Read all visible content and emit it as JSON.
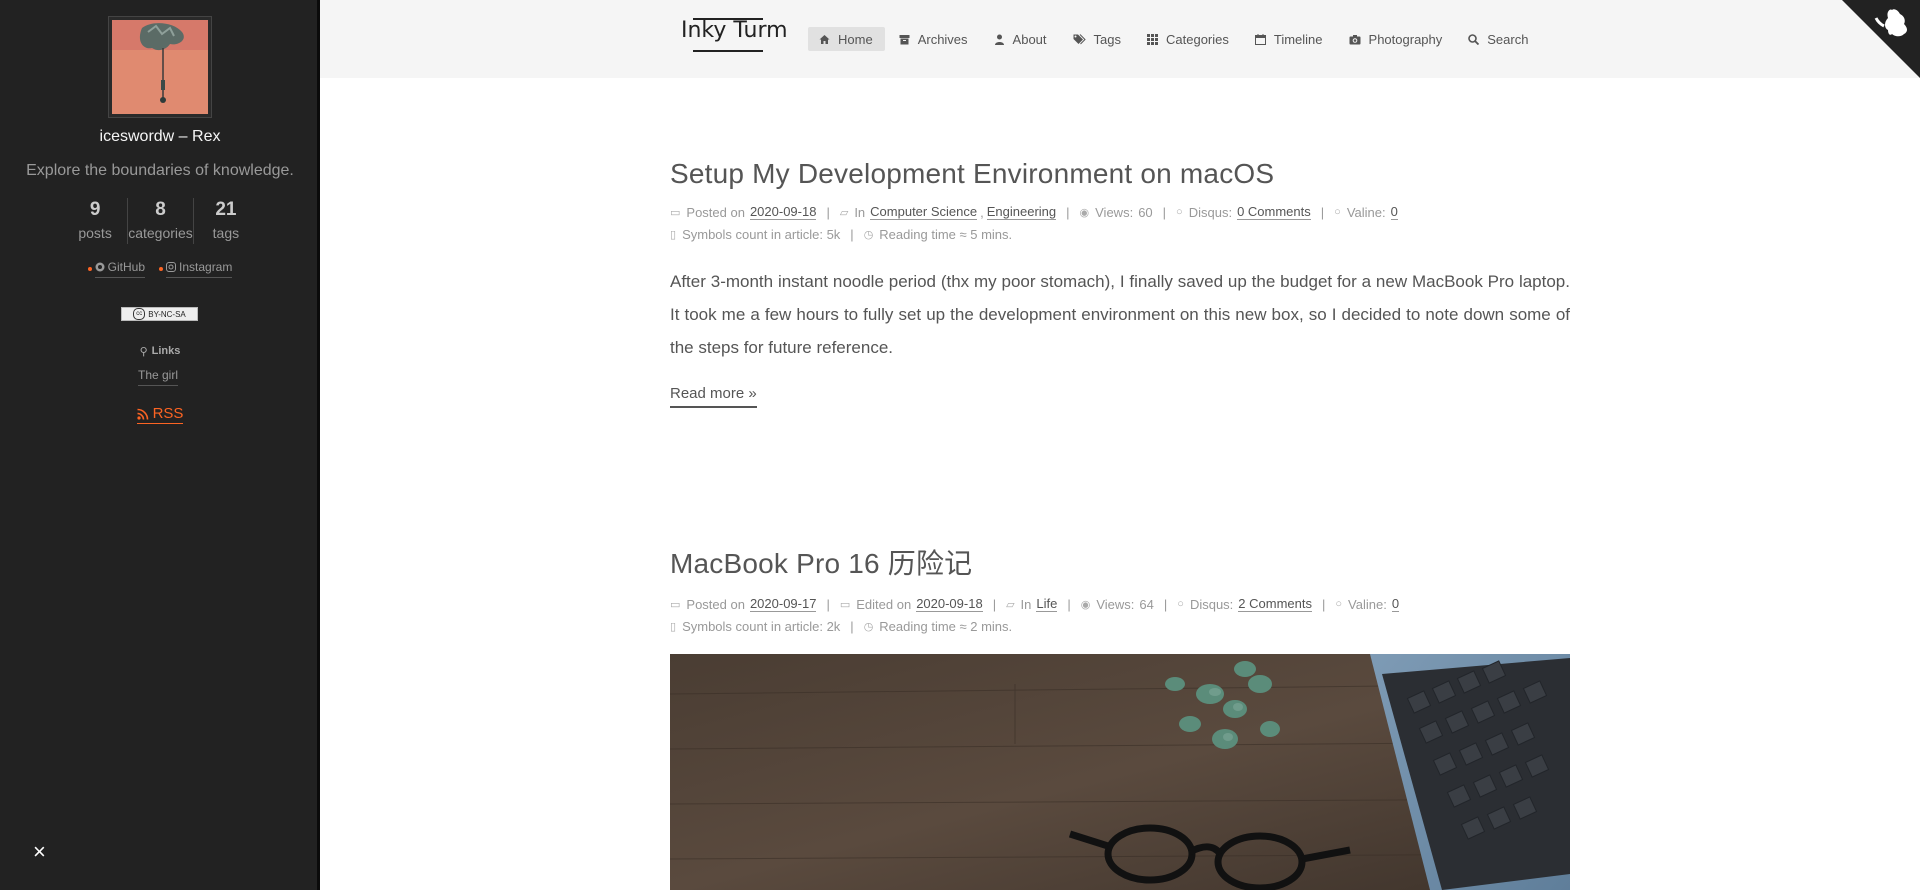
{
  "sidebar": {
    "author": "iceswordw – Rex",
    "motto": "Explore the boundaries of knowledge.",
    "stats": [
      {
        "num": "9",
        "label": "posts"
      },
      {
        "num": "8",
        "label": "categories"
      },
      {
        "num": "21",
        "label": "tags"
      }
    ],
    "social": [
      {
        "icon": "github-icon",
        "label": "GitHub"
      },
      {
        "icon": "instagram-icon",
        "label": "Instagram"
      }
    ],
    "license": "BY-NC-SA",
    "links_title": "Links",
    "links": [
      "The girl"
    ],
    "rss": "RSS",
    "close": "×"
  },
  "header": {
    "brand": "Inky Turm",
    "nav": [
      {
        "label": "Home",
        "icon": "home-icon"
      },
      {
        "label": "Archives",
        "icon": "archive-icon"
      },
      {
        "label": "About",
        "icon": "user-icon"
      },
      {
        "label": "Tags",
        "icon": "tags-icon"
      },
      {
        "label": "Categories",
        "icon": "grid-icon"
      },
      {
        "label": "Timeline",
        "icon": "calendar-icon"
      },
      {
        "label": "Photography",
        "icon": "camera-icon"
      },
      {
        "label": "Search",
        "icon": "search-icon"
      }
    ]
  },
  "posts": [
    {
      "title": "Setup My Development Environment on macOS",
      "posted_label": "Posted on",
      "posted": "2020-09-18",
      "in_label": "In",
      "categories": [
        "Computer Science",
        "Engineering"
      ],
      "views_label": "Views:",
      "views": "60",
      "disqus_label": "Disqus:",
      "disqus": "0 Comments",
      "valine_label": "Valine:",
      "valine": "0",
      "symbols": "Symbols count in article: 5k",
      "reading": "Reading time ≈ 5 mins.",
      "excerpt": "After 3-month instant noodle period (thx my poor stomach), I finally saved up the budget for a new MacBook Pro laptop. It took me a few hours to fully set up the development environment on this new box, so I decided to note down some of the steps for future reference.",
      "read_more": "Read more »"
    },
    {
      "title": "MacBook Pro 16 历险记",
      "posted_label": "Posted on",
      "posted": "2020-09-17",
      "edited_label": "Edited on",
      "edited": "2020-09-18",
      "in_label": "In",
      "categories": [
        "Life"
      ],
      "views_label": "Views:",
      "views": "64",
      "disqus_label": "Disqus:",
      "disqus": "2 Comments",
      "valine_label": "Valine:",
      "valine": "0",
      "symbols": "Symbols count in article: 2k",
      "reading": "Reading time ≈ 2 mins."
    }
  ],
  "colors": {
    "sidebar_bg": "#222222",
    "accent_rss": "#fc6423",
    "header_bg": "#f5f5f5"
  }
}
